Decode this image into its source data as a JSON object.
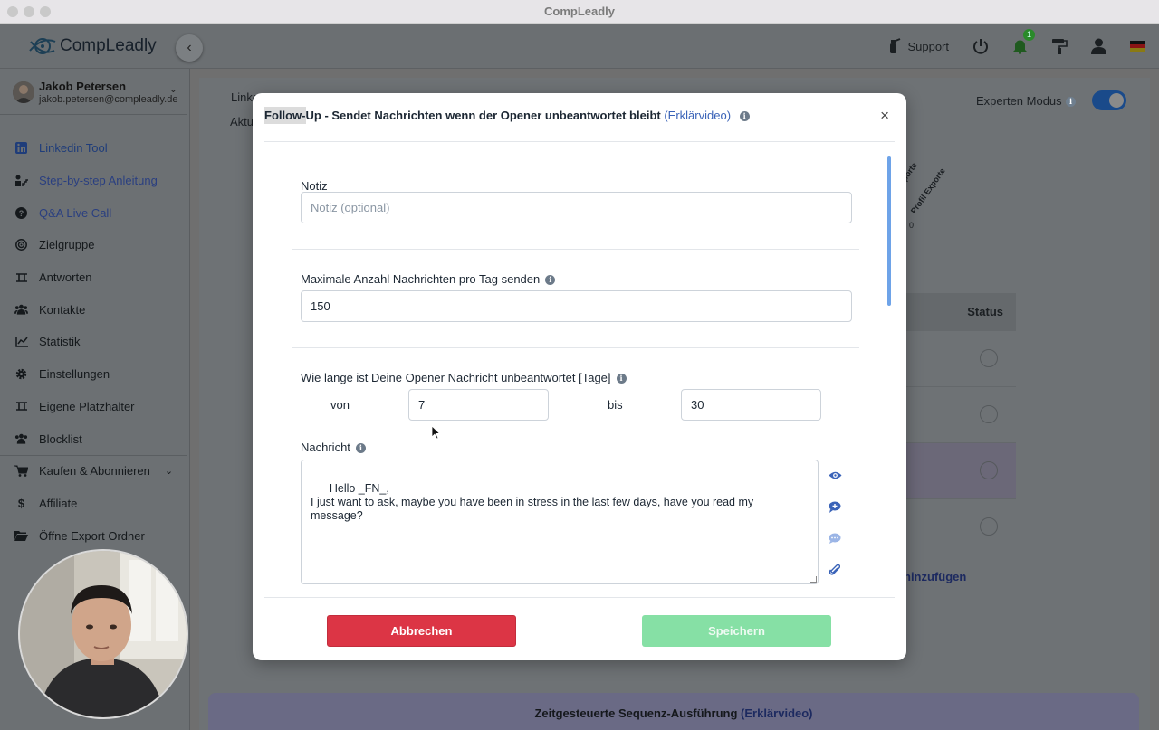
{
  "window": {
    "title": "CompLeadly"
  },
  "header": {
    "logo_text": "CompLeadly",
    "support_label": "Support",
    "notification_count": "1"
  },
  "user": {
    "name": "Jakob Petersen",
    "email": "jakob.petersen@compleadly.de"
  },
  "sidebar": {
    "items": [
      {
        "label": "Linkedin Tool",
        "icon": "linkedin-icon"
      },
      {
        "label": "Step-by-step Anleitung",
        "icon": "steps-icon"
      },
      {
        "label": "Q&A Live Call",
        "icon": "question-icon"
      },
      {
        "label": "Zielgruppe",
        "icon": "target-icon"
      },
      {
        "label": "Antworten",
        "icon": "reply-icon"
      },
      {
        "label": "Kontakte",
        "icon": "contacts-icon"
      },
      {
        "label": "Statistik",
        "icon": "chart-icon"
      },
      {
        "label": "Einstellungen",
        "icon": "gear-icon"
      },
      {
        "label": "Eigene Platzhalter",
        "icon": "placeholder-icon"
      },
      {
        "label": "Blocklist",
        "icon": "block-icon"
      },
      {
        "label": "Kaufen & Abonnieren",
        "icon": "cart-icon"
      },
      {
        "label": "Affiliate",
        "icon": "dollar-icon"
      },
      {
        "label": "Öffne Export Ordner",
        "icon": "folder-icon"
      }
    ]
  },
  "background": {
    "tab_partial_1": "Linke",
    "tab_partial_2": "Aktu",
    "expert_mode_label": "Experten Modus",
    "status_header": "Status",
    "rotated_label_1": "xporte",
    "rotated_label_2": "Profil Exporte",
    "zero_label": "0",
    "add_link": "hinzufügen",
    "bottom_bar_text": "Zeitgesteuerte Sequenz-Ausführung",
    "bottom_bar_link": "(Erklärvideo)"
  },
  "modal": {
    "title_highlight": "Follow-",
    "title_rest": "Up - Sendet Nachrichten wenn der Opener unbeantwortet bleibt",
    "title_link": "(Erklärvideo)",
    "close_label": "×",
    "notiz_label": "Notiz",
    "notiz_placeholder": "Notiz (optional)",
    "max_label": "Maximale Anzahl Nachrichten pro Tag senden",
    "max_value": "150",
    "days_label": "Wie lange ist Deine Opener Nachricht unbeantwortet [Tage]",
    "von_label": "von",
    "von_value": "7",
    "bis_label": "bis",
    "bis_value": "30",
    "message_label": "Nachricht",
    "message_value": "Hello _FN_,\nI just want to ask, maybe you have been in stress in the last few days, have you read my message?",
    "cancel_label": "Abbrechen",
    "save_label": "Speichern"
  },
  "colors": {
    "cancel": "#dc3545",
    "save_disabled": "#86e0a5",
    "link": "#3a63b8",
    "toggle": "#1a4a8a"
  }
}
